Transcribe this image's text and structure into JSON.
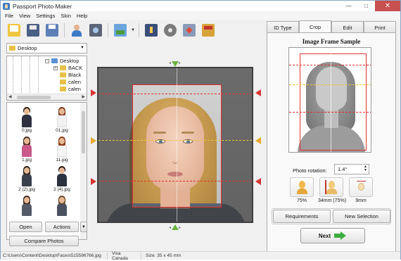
{
  "window": {
    "title": "Passport Photo Maker"
  },
  "menu": [
    "File",
    "View",
    "Settings",
    "Skin",
    "Help"
  ],
  "toolbar": {
    "buttons": [
      "open-folder-icon",
      "save-icon",
      "print-icon",
      "person-icon",
      "camera-icon",
      "photo-enhance-icon",
      "book-icon",
      "film-icon",
      "cut-icon",
      "layout-icon"
    ]
  },
  "left_panel": {
    "location": "Desktop",
    "tree": [
      {
        "label": "Desktop",
        "expanded": true
      },
      {
        "label": "BACK",
        "expanded": false
      },
      {
        "label": "Black"
      },
      {
        "label": "calen"
      },
      {
        "label": "calen"
      }
    ],
    "thumbnails": [
      {
        "name": "0.jpg"
      },
      {
        "name": "01.jpg"
      },
      {
        "name": "1.jpg"
      },
      {
        "name": "11.jpg"
      },
      {
        "name": "2 (2).jpg"
      },
      {
        "name": "2 (4).jpg"
      },
      {
        "name": ""
      },
      {
        "name": ""
      }
    ],
    "open_label": "Open",
    "actions_label": "Actions",
    "compare_label": "Compare Photos"
  },
  "right_panel": {
    "tabs": [
      "ID Type",
      "Crop",
      "Edit",
      "Print"
    ],
    "active_tab": "Crop",
    "sample_title": "Image Frame Sample",
    "rotation_label": "Photo rotation:",
    "rotation_value": "1.4°",
    "size_options": [
      {
        "label": "75%",
        "icon": "head-size-icon"
      },
      {
        "label": "34mm (75%)",
        "icon": "head-measure-icon"
      },
      {
        "label": "9mm",
        "icon": "crown-gap-icon"
      }
    ],
    "requirements_label": "Requirements",
    "new_selection_label": "New Selection",
    "next_label": "Next"
  },
  "status": {
    "path": "C:\\Users\\Content\\Desktop\\Faces\\515596766.jpg",
    "id_type": "Visa Canada",
    "size": "Size: 35 x 45 mm"
  },
  "colors": {
    "crop_frame": "#e03030",
    "eye_line": "#e8c634",
    "center_marker": "#6cb33f",
    "next_arrow": "#3cae3c"
  }
}
